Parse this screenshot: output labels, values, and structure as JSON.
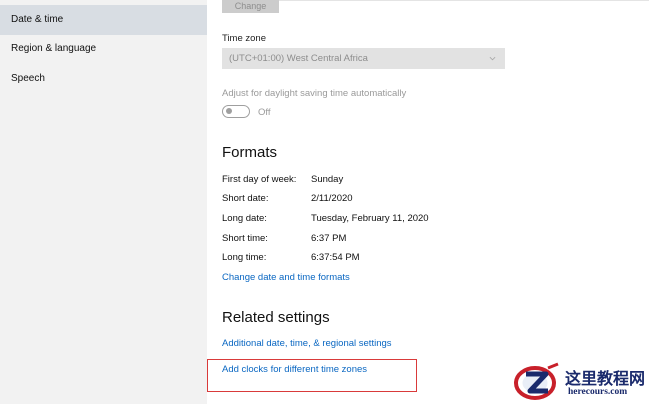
{
  "sidebar": {
    "items": [
      {
        "label": "Date & time",
        "active": true
      },
      {
        "label": "Region & language",
        "active": false
      },
      {
        "label": "Speech",
        "active": false
      }
    ]
  },
  "main": {
    "change_button_label": "Change",
    "time_zone": {
      "label": "Time zone",
      "value": "(UTC+01:00) West Central Africa",
      "icon": "chevron-down-icon"
    },
    "dst": {
      "label": "Adjust for daylight saving time automatically",
      "toggle_state": "Off"
    },
    "formats": {
      "heading": "Formats",
      "rows": [
        {
          "label": "First day of week:",
          "value": "Sunday"
        },
        {
          "label": "Short date:",
          "value": "2/11/2020"
        },
        {
          "label": "Long date:",
          "value": "Tuesday, February 11, 2020"
        },
        {
          "label": "Short time:",
          "value": "6:37 PM"
        },
        {
          "label": "Long time:",
          "value": "6:37:54 PM"
        }
      ],
      "change_link": "Change date and time formats"
    },
    "related": {
      "heading": "Related settings",
      "links": [
        "Additional date, time, & regional settings",
        "Add clocks for different time zones"
      ]
    }
  },
  "watermark": {
    "title": "这里教程网",
    "domain": "herecours.com"
  },
  "colors": {
    "accent": "#0a67c2",
    "highlight": "#d93a3a",
    "sidebar_bg": "#f2f2f2",
    "sidebar_active": "#d8dde3"
  }
}
